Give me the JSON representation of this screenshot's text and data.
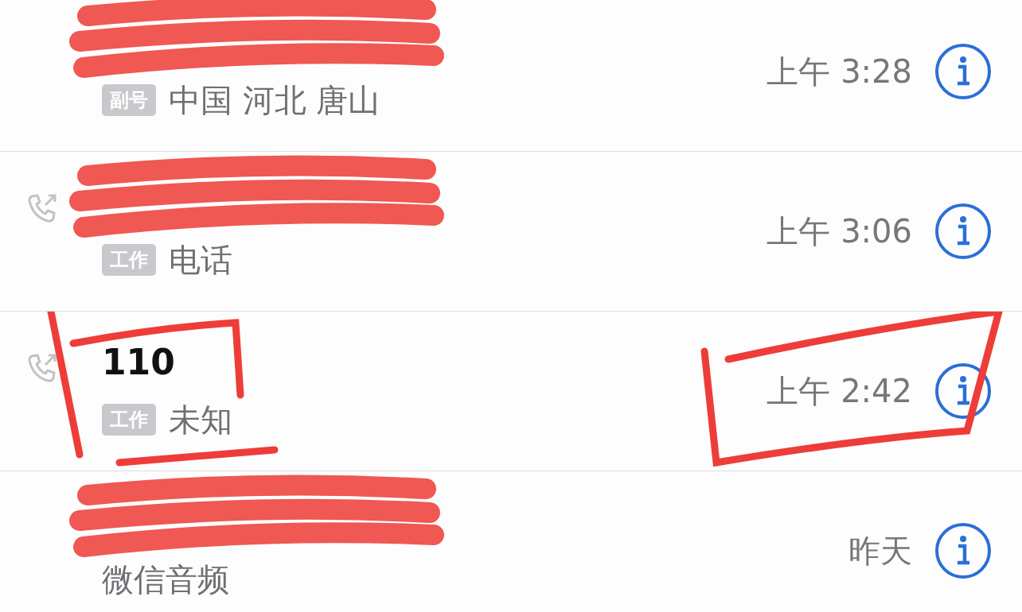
{
  "calls": [
    {
      "name_redacted": true,
      "outgoing": false,
      "highlighted": false,
      "label": "副号",
      "detail": "中国 河北 唐山",
      "time": "上午 3:28"
    },
    {
      "name_redacted": true,
      "outgoing": true,
      "highlighted": false,
      "label": "工作",
      "detail": "电话",
      "time": "上午 3:06"
    },
    {
      "name": "110",
      "name_redacted": false,
      "outgoing": true,
      "highlighted": true,
      "label": "工作",
      "detail": "未知",
      "time": "上午 2:42"
    },
    {
      "name_redacted": true,
      "outgoing": false,
      "highlighted": false,
      "detail": "微信音频",
      "time": "昨天"
    }
  ]
}
